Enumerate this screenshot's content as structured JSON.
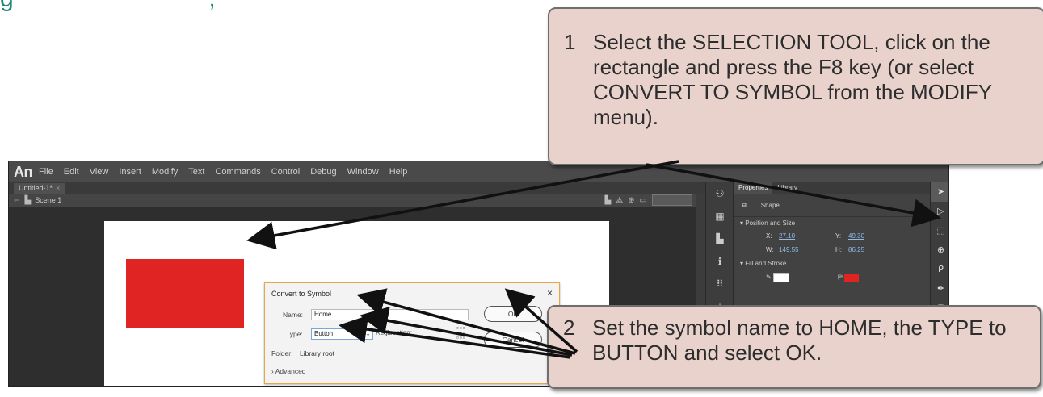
{
  "heading": {
    "fragment": "g      ,                    ,"
  },
  "app": {
    "logo": "An",
    "menu": [
      "File",
      "Edit",
      "View",
      "Insert",
      "Modify",
      "Text",
      "Commands",
      "Control",
      "Debug",
      "Window",
      "Help"
    ],
    "doc_tab": "Untitled-1*",
    "doc_tab_close": "×",
    "scene_label": "Scene 1"
  },
  "dialog": {
    "title": "Convert to Symbol",
    "close": "×",
    "name_label": "Name:",
    "name_value": "Home",
    "type_label": "Type:",
    "type_value": "Button",
    "registration_label": "Registration:",
    "folder_label": "Folder:",
    "folder_value": "Library root",
    "advanced_label": "› Advanced",
    "ok_label": "OK",
    "cancel_label": "Cancel"
  },
  "properties": {
    "tabs": [
      "Properties",
      "Library"
    ],
    "object_type": "Shape",
    "position_section": "▾ Position and Size",
    "x_label": "X:",
    "x_value": "27.10",
    "y_label": "Y:",
    "y_value": "49.30",
    "w_label": "W:",
    "w_value": "149.55",
    "h_label": "H:",
    "h_value": "86.25",
    "fill_section": "▾ Fill and Stroke",
    "fill_color": "#e02424"
  },
  "callouts": {
    "step1_number": "1",
    "step1_text": "Select the SELECTION TOOL, click on the rectangle and press the F8 key (or select CONVERT TO SYMBOL from the MODIFY menu).",
    "step2_number": "2",
    "step2_text": "Set the symbol name to HOME, the TYPE to BUTTON and select OK."
  },
  "colors": {
    "callout_bg": "#e8d2cb",
    "rect_fill": "#e02424",
    "dialog_border": "#e6a64a",
    "heading": "#1f8a78"
  },
  "icons": [
    "selection-tool-icon",
    "subselection-tool-icon",
    "free-transform-icon",
    "lasso-icon",
    "pen-icon",
    "text-icon"
  ]
}
